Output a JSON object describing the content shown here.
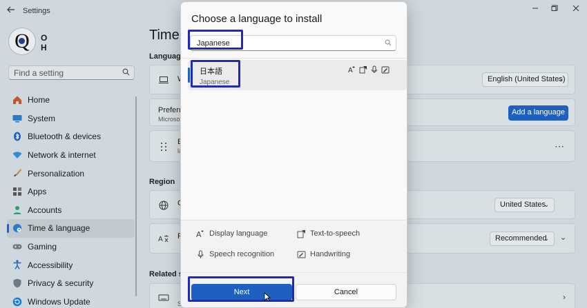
{
  "window": {
    "title": "Settings",
    "back_icon": "back-arrow-icon",
    "minimize_icon": "minimize-icon",
    "maximize_icon": "maximize-icon",
    "close_icon": "close-icon"
  },
  "profile": {
    "avatar_letter": "Q",
    "name": "O H"
  },
  "sidebar": {
    "search_placeholder": "Find a setting",
    "items": [
      {
        "label": "Home",
        "icon": "home-icon"
      },
      {
        "label": "System",
        "icon": "system-icon"
      },
      {
        "label": "Bluetooth & devices",
        "icon": "bluetooth-icon"
      },
      {
        "label": "Network & internet",
        "icon": "wifi-icon"
      },
      {
        "label": "Personalization",
        "icon": "brush-icon"
      },
      {
        "label": "Apps",
        "icon": "apps-icon"
      },
      {
        "label": "Accounts",
        "icon": "accounts-icon"
      },
      {
        "label": "Time & language",
        "icon": "globe-clock-icon",
        "selected": true
      },
      {
        "label": "Gaming",
        "icon": "gamepad-icon"
      },
      {
        "label": "Accessibility",
        "icon": "accessibility-icon"
      },
      {
        "label": "Privacy & security",
        "icon": "shield-icon"
      },
      {
        "label": "Windows Update",
        "icon": "update-icon"
      }
    ]
  },
  "main": {
    "page_title": "Time",
    "language_section": "Language",
    "windows_display_language_partial": "W",
    "display_language_value": "English (United States)",
    "preferred_title_partial": "Preferre",
    "preferred_sub_partial": "Microsof",
    "add_language_label": "Add a language",
    "english_row_partial": "E",
    "english_row_sub_partial": "la",
    "more_icon": "ellipsis-icon",
    "region_section": "Region",
    "country_partial": "C",
    "country_value": "United States",
    "regional_format_partial": "R",
    "regional_format_value": "Recommended",
    "related_section_partial": "Related se",
    "related_sub_partial": "S"
  },
  "dialog": {
    "title": "Choose a language to install",
    "search_value": "Japanese",
    "result": {
      "native_name": "日本語",
      "english_name": "Japanese",
      "feature_icons": [
        "display-language-icon",
        "text-to-speech-icon",
        "speech-recognition-icon",
        "handwriting-icon"
      ]
    },
    "legend": {
      "display_language": "Display language",
      "text_to_speech": "Text-to-speech",
      "speech_recognition": "Speech recognition",
      "handwriting": "Handwriting"
    },
    "next_label": "Next",
    "cancel_label": "Cancel"
  },
  "colors": {
    "accent": "#1f5fbf",
    "highlight_box": "#1f2bb8"
  }
}
